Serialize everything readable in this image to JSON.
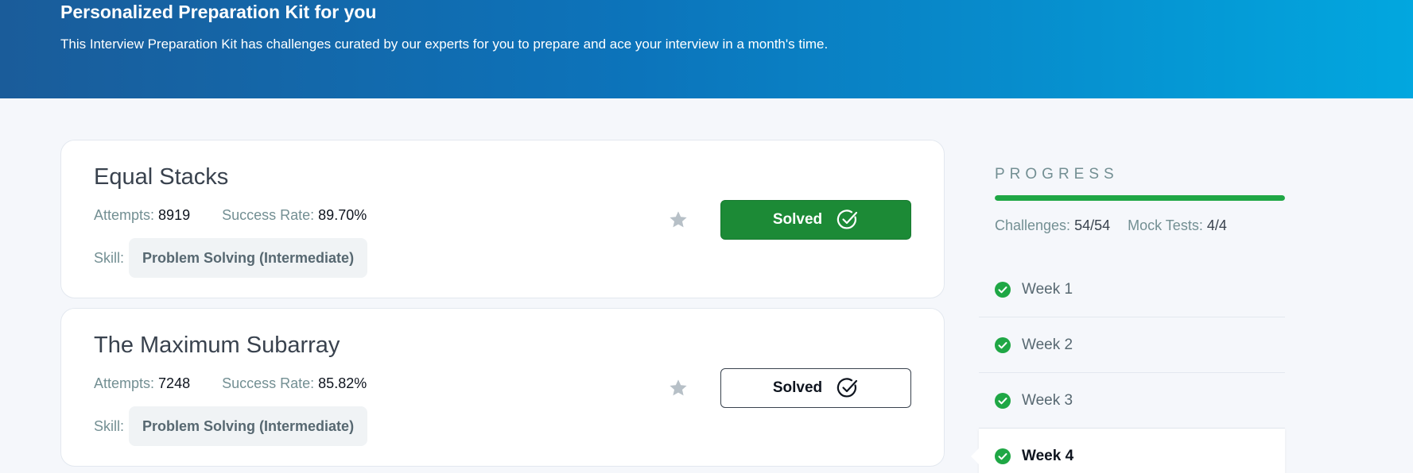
{
  "banner": {
    "title": "Personalized Preparation Kit for you",
    "subtitle": "This Interview Preparation Kit has challenges curated by our experts for you to prepare and ace your interview in a month's time."
  },
  "challenges": [
    {
      "title": "Equal Stacks",
      "attempts_label": "Attempts:",
      "attempts": "8919",
      "success_label": "Success Rate:",
      "success": "89.70%",
      "skill_label": "Skill:",
      "skill": "Problem Solving (Intermediate)",
      "button_label": "Solved",
      "button_style": "filled"
    },
    {
      "title": "The Maximum Subarray",
      "attempts_label": "Attempts:",
      "attempts": "7248",
      "success_label": "Success Rate:",
      "success": "85.82%",
      "skill_label": "Skill:",
      "skill": "Problem Solving (Intermediate)",
      "button_label": "Solved",
      "button_style": "outline"
    }
  ],
  "progress": {
    "label": "PROGRESS",
    "fraction": 1.0,
    "challenges_label": "Challenges:",
    "challenges": "54/54",
    "mock_label": "Mock Tests:",
    "mock": "4/4"
  },
  "weeks": [
    {
      "label": "Week 1",
      "status": "complete"
    },
    {
      "label": "Week 2",
      "status": "complete"
    },
    {
      "label": "Week 3",
      "status": "complete"
    },
    {
      "label": "Week 4",
      "status": "complete",
      "active": true
    }
  ],
  "colors": {
    "solved_green": "#1c8a36",
    "progress_green": "#1fa745",
    "banner_start": "#1a5c9a",
    "banner_end": "#02a7df",
    "star_gray": "#b7c0c7"
  },
  "icons": {
    "star": "star-icon",
    "solved": "check-circle-icon",
    "week_complete": "check-badge-icon"
  }
}
